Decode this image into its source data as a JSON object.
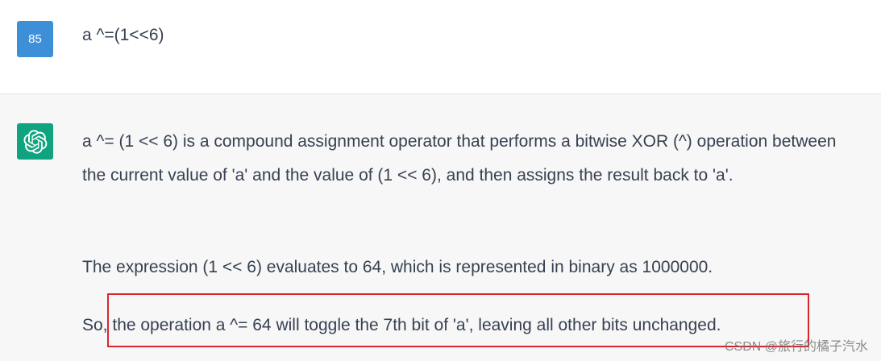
{
  "user_message": {
    "avatar_label": "85",
    "text": "a ^=(1<<6)"
  },
  "assistant_message": {
    "avatar_icon": "openai-logo-icon",
    "paragraph1": "a ^= (1 << 6) is a compound assignment operator that performs a bitwise XOR (^) operation between the current value of 'a' and the value of (1 << 6), and then assigns the result back to 'a'.",
    "paragraph2": "The expression (1 << 6) evaluates to 64, which is represented in binary as 1000000.",
    "paragraph3": "So, the operation a ^= 64 will toggle the 7th bit of 'a', leaving all other bits unchanged."
  },
  "watermark": "CSDN @旅行的橘子汽水",
  "colors": {
    "user_avatar": "#3d8fd8",
    "bot_avatar": "#10a37f",
    "highlight_border": "#d9262e",
    "assistant_bg": "#f7f7f8",
    "user_bg": "#ffffff"
  }
}
